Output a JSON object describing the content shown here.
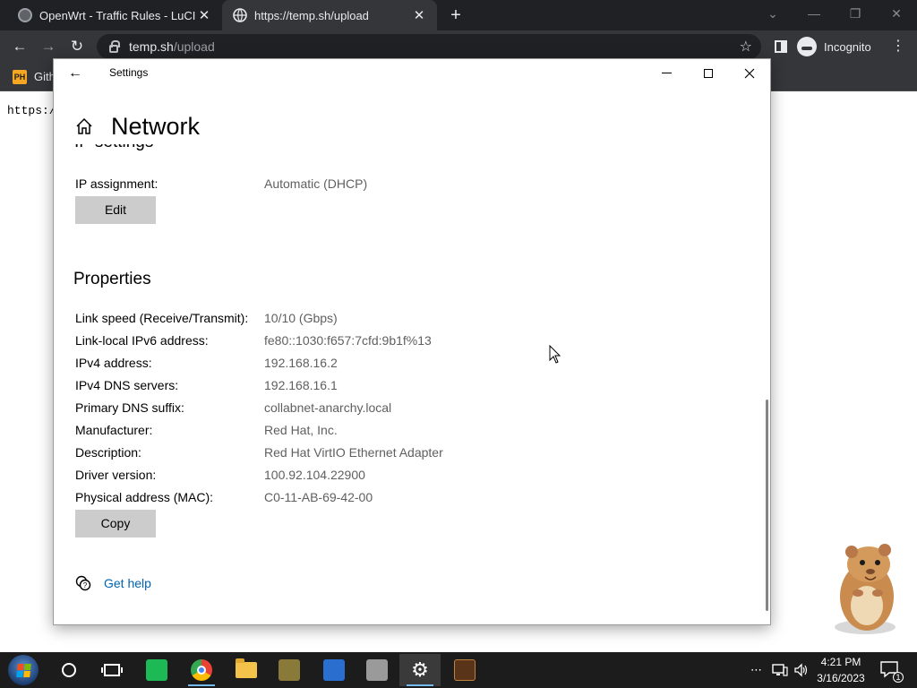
{
  "browser": {
    "tabs": [
      {
        "title": "OpenWrt - Traffic Rules - LuCI",
        "close": "✕"
      },
      {
        "title": "https://temp.sh/upload",
        "close": "✕"
      }
    ],
    "new_tab": "+",
    "window_controls": {
      "minimize": "—",
      "restore": "❐",
      "close": "✕"
    },
    "address": {
      "host": "temp.sh",
      "path": "/upload"
    },
    "profile_label": "Incognito",
    "bookmark": {
      "icon_text": "PH",
      "label": "Gith"
    },
    "page_text": "https:/"
  },
  "settings": {
    "title": "Settings",
    "page_title": "Network",
    "cut_section_heading": "IP settings",
    "ip_assignment": {
      "label": "IP assignment:",
      "value": "Automatic (DHCP)"
    },
    "edit_button": "Edit",
    "properties_heading": "Properties",
    "properties": [
      {
        "label": "Link speed (Receive/Transmit):",
        "value": "10/10 (Gbps)"
      },
      {
        "label": "Link-local IPv6 address:",
        "value": "fe80::1030:f657:7cfd:9b1f%13"
      },
      {
        "label": "IPv4 address:",
        "value": "192.168.16.2"
      },
      {
        "label": "IPv4 DNS servers:",
        "value": "192.168.16.1"
      },
      {
        "label": "Primary DNS suffix:",
        "value": "collabnet-anarchy.local"
      },
      {
        "label": "Manufacturer:",
        "value": "Red Hat, Inc."
      },
      {
        "label": "Description:",
        "value": "Red Hat VirtIO Ethernet Adapter"
      },
      {
        "label": "Driver version:",
        "value": "100.92.104.22900"
      },
      {
        "label": "Physical address (MAC):",
        "value": "C0-11-AB-69-42-00"
      }
    ],
    "copy_button": "Copy",
    "get_help": "Get help",
    "link_color": "#0063b1"
  },
  "taskbar": {
    "clock_time": "4:21 PM",
    "clock_date": "3/16/2023",
    "overflow": "⋯",
    "notifications_count": "1"
  },
  "colors": {
    "chrome_dark": "#202124",
    "chrome_toolbar": "#35363a",
    "taskbar": "#1c1c1c",
    "button_gray": "#cccccc"
  }
}
